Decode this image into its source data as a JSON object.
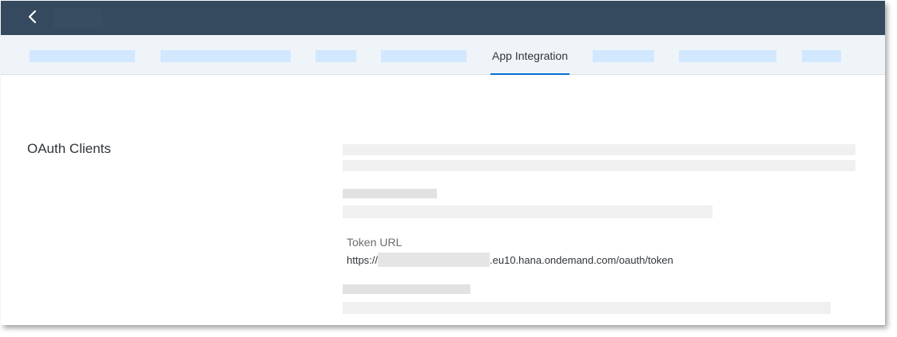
{
  "tabs": {
    "active_label": "App Integration"
  },
  "section": {
    "title": "OAuth Clients"
  },
  "token_url": {
    "label": "Token URL",
    "prefix": "https://",
    "suffix": ".eu10.hana.ondemand.com/oauth/token"
  },
  "colors": {
    "shellbar": "#354a5f",
    "tabbar": "#eff4f9",
    "accent": "#0a6ed1"
  }
}
